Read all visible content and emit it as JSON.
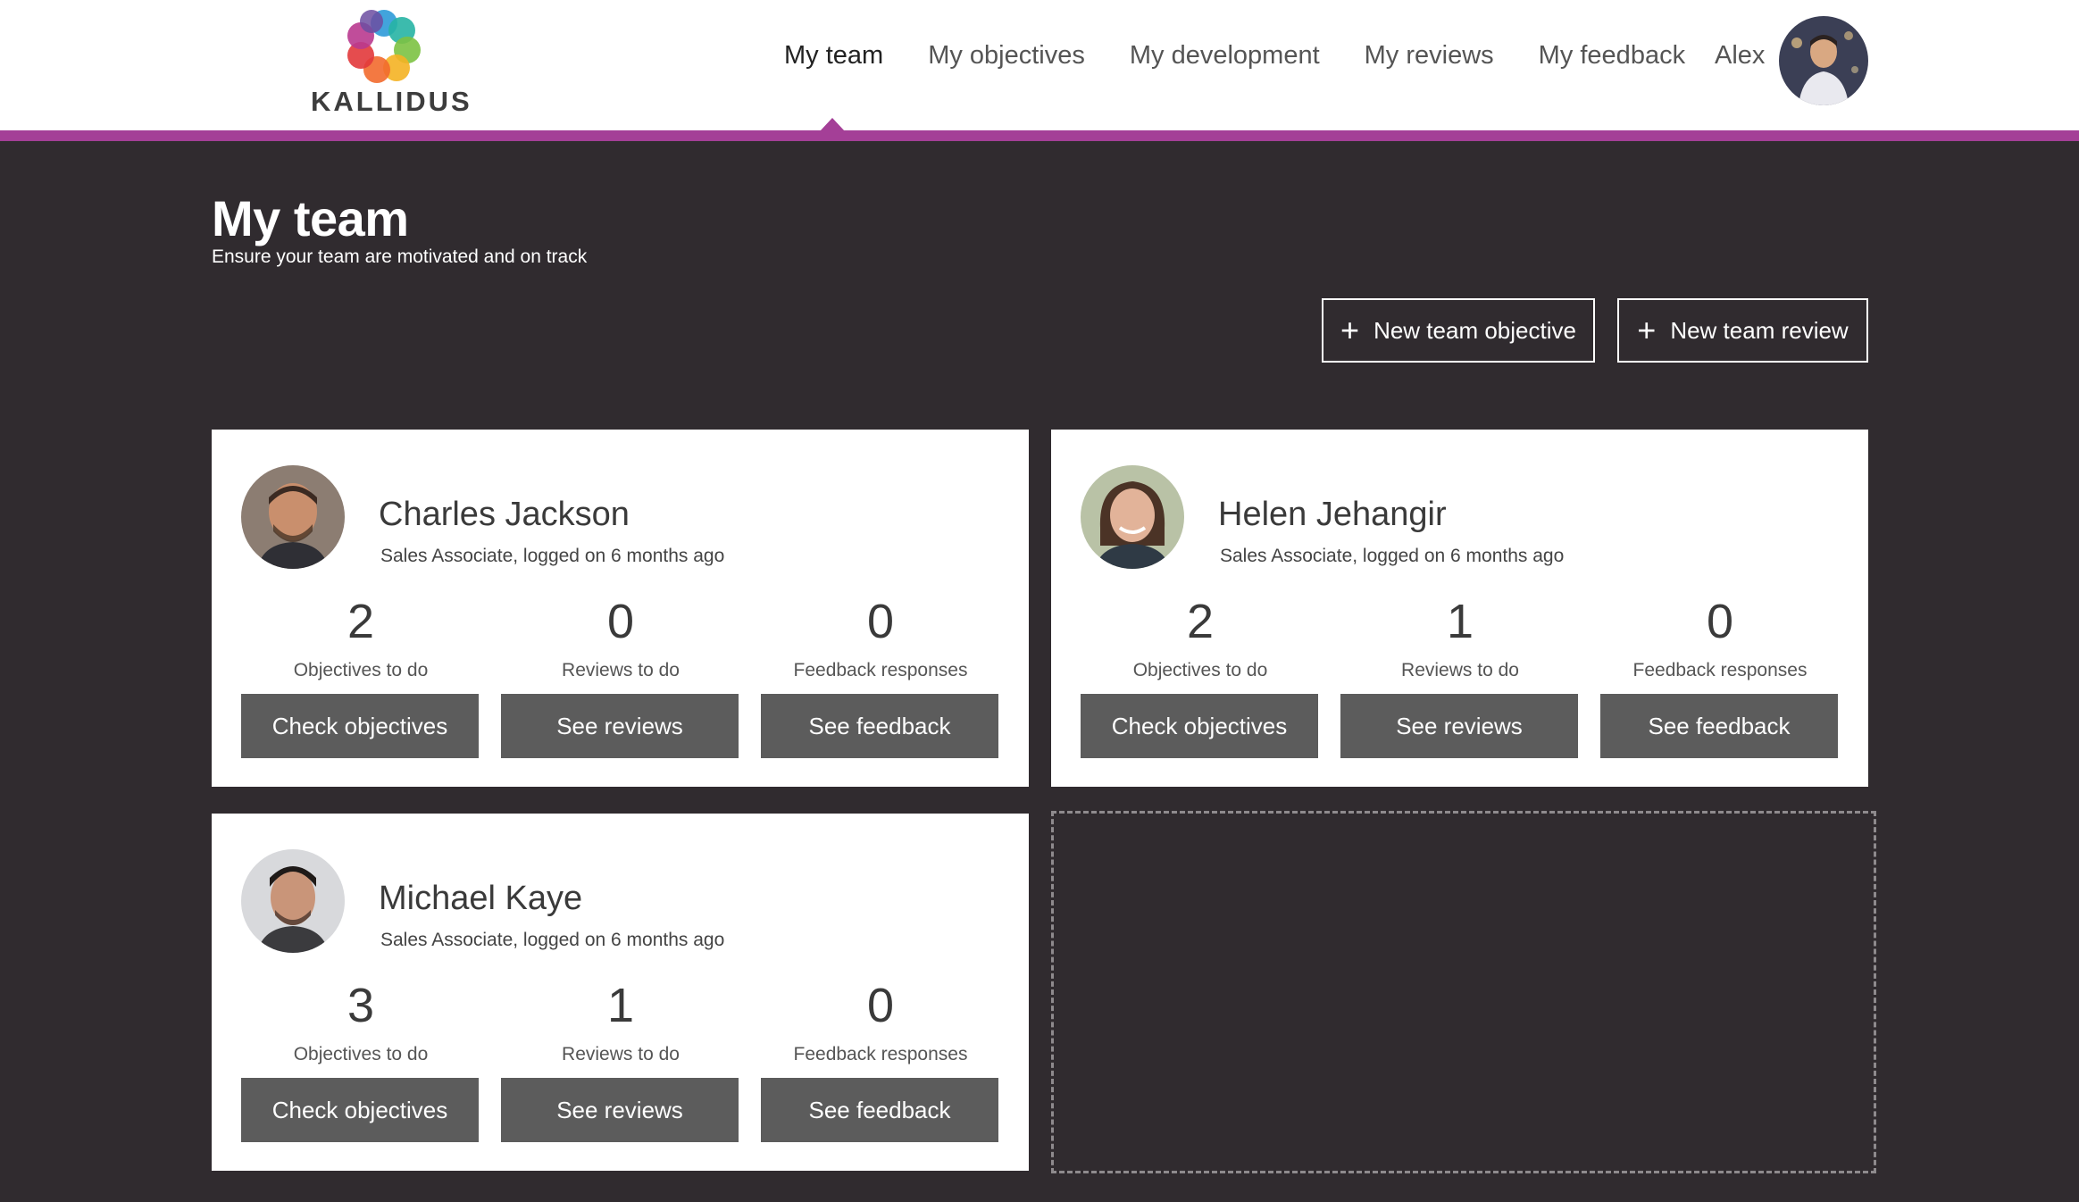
{
  "brand": {
    "name": "KALLIDUS",
    "accent": "#a43f97"
  },
  "nav": {
    "items": [
      {
        "label": "My team",
        "active": true
      },
      {
        "label": "My objectives",
        "active": false
      },
      {
        "label": "My development",
        "active": false
      },
      {
        "label": "My reviews",
        "active": false
      },
      {
        "label": "My feedback",
        "active": false
      }
    ],
    "user_name": "Alex",
    "avatar_icon": "user-avatar"
  },
  "page": {
    "title": "My team",
    "subtitle": "Ensure your team are motivated and on track"
  },
  "actions": {
    "new_objective": "New team objective",
    "new_review": "New team review",
    "plus_icon": "+"
  },
  "team": [
    {
      "name": "Charles Jackson",
      "role": "Sales Associate, logged on 6 months ago",
      "stats": [
        {
          "value": "2",
          "label": "Objectives to do"
        },
        {
          "value": "0",
          "label": "Reviews to do"
        },
        {
          "value": "0",
          "label": "Feedback responses"
        }
      ],
      "buttons": [
        "Check objectives",
        "See reviews",
        "See feedback"
      ]
    },
    {
      "name": "Helen Jehangir",
      "role": "Sales Associate, logged on 6 months ago",
      "stats": [
        {
          "value": "2",
          "label": "Objectives to do"
        },
        {
          "value": "1",
          "label": "Reviews to do"
        },
        {
          "value": "0",
          "label": "Feedback responses"
        }
      ],
      "buttons": [
        "Check objectives",
        "See reviews",
        "See feedback"
      ]
    },
    {
      "name": "Michael Kaye",
      "role": "Sales Associate, logged on 6 months ago",
      "stats": [
        {
          "value": "3",
          "label": "Objectives to do"
        },
        {
          "value": "1",
          "label": "Reviews to do"
        },
        {
          "value": "0",
          "label": "Feedback responses"
        }
      ],
      "buttons": [
        "Check objectives",
        "See reviews",
        "See feedback"
      ]
    }
  ]
}
